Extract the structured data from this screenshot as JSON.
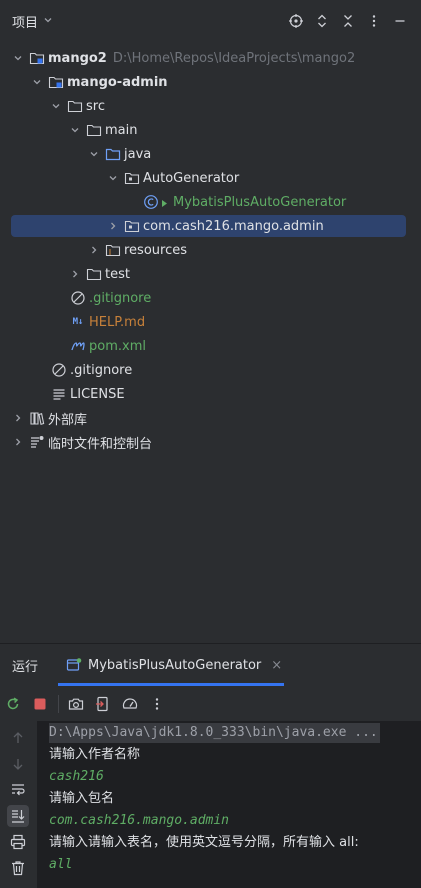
{
  "project_panel": {
    "title": "项目",
    "tree": [
      {
        "label": "mango2",
        "path": "D:\\Home\\Repos\\IdeaProjects\\mango2"
      },
      {
        "label": "mango-admin"
      },
      {
        "label": "src"
      },
      {
        "label": "main"
      },
      {
        "label": "java"
      },
      {
        "label": "AutoGenerator"
      },
      {
        "label": "MybatisPlusAutoGenerator"
      },
      {
        "label": "com.cash216.mango.admin"
      },
      {
        "label": "resources"
      },
      {
        "label": "test"
      },
      {
        "label": ".gitignore"
      },
      {
        "label": "HELP.md",
        "icon_text": "M↓"
      },
      {
        "label": "pom.xml"
      },
      {
        "label": ".gitignore"
      },
      {
        "label": "LICENSE"
      },
      {
        "label": "外部库"
      },
      {
        "label": "临时文件和控制台"
      }
    ]
  },
  "run_panel": {
    "label": "运行",
    "tab_label": "MybatisPlusAutoGenerator",
    "tab_close": "×",
    "console": [
      "D:\\Apps\\Java\\jdk1.8.0_333\\bin\\java.exe ...",
      "请输入作者名称",
      "cash216",
      "请输入包名",
      "com.cash216.mango.admin",
      "请输入请输入表名，使用英文逗号分隔，所有输入 all:",
      "all"
    ]
  },
  "colors": {
    "background": "#2b2d30",
    "console_background": "#1e1f22",
    "selection": "#2e436e",
    "accent": "#3574f0",
    "green_text": "#5fad65",
    "orange_text": "#c7813a",
    "path_gray": "#6f737a"
  }
}
